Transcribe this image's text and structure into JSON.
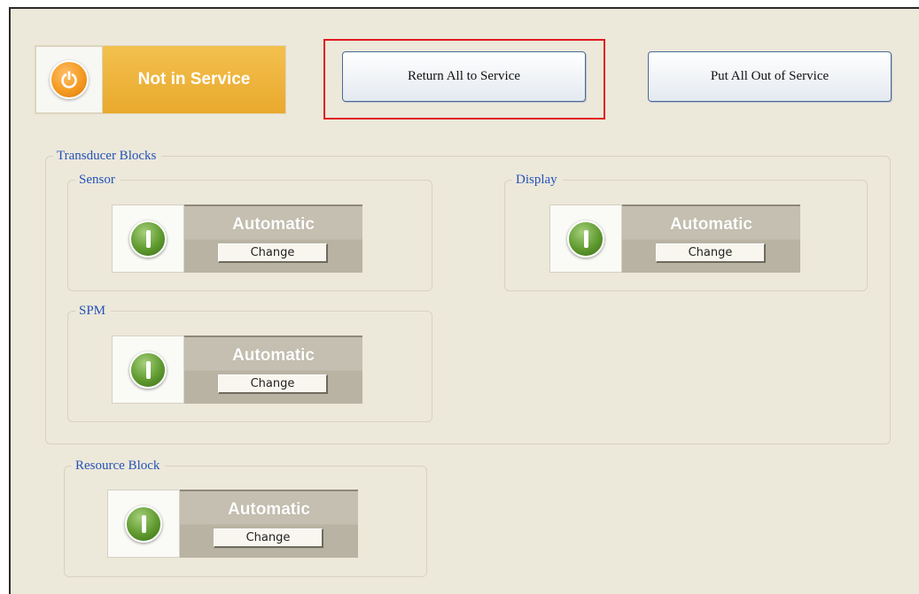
{
  "service": {
    "status_label": "Not in Service",
    "icon": "power-icon",
    "color": "#eeb43e"
  },
  "actions": {
    "return_all_label": "Return All to Service",
    "put_all_out_label": "Put All Out of Service",
    "highlight_color": "#e0191e"
  },
  "transducer_blocks": {
    "title": "Transducer Blocks",
    "sensor": {
      "title": "Sensor",
      "mode": "Automatic",
      "change_label": "Change"
    },
    "display": {
      "title": "Display",
      "mode": "Automatic",
      "change_label": "Change"
    },
    "spm": {
      "title": "SPM",
      "mode": "Automatic",
      "change_label": "Change"
    }
  },
  "resource_block": {
    "title": "Resource Block",
    "mode": "Automatic",
    "change_label": "Change"
  },
  "colors": {
    "background": "#ece8da",
    "group_title": "#2452b8",
    "automatic_icon": "#5f9a2f"
  }
}
